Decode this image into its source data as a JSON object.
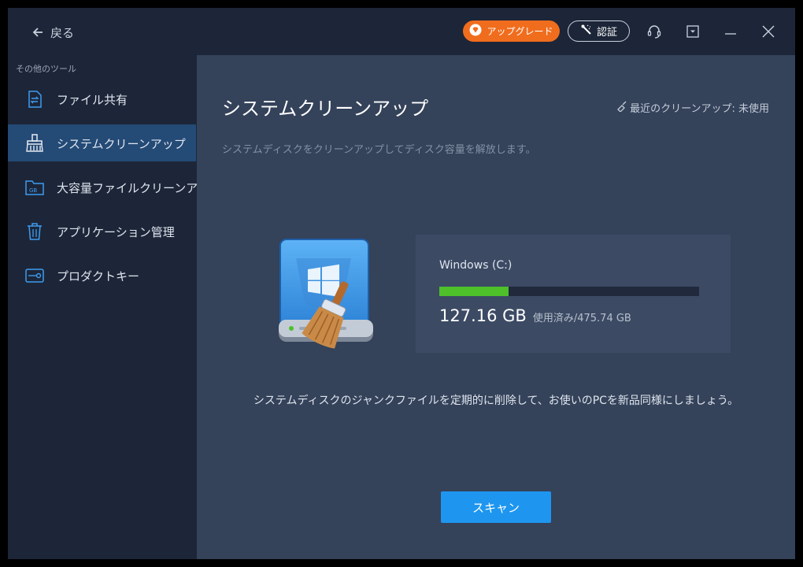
{
  "titlebar": {
    "back_label": "戻る",
    "upgrade_label": "アップグレード",
    "activate_label": "認証",
    "icons": [
      "support-icon",
      "menu-icon",
      "minimize-icon",
      "close-icon"
    ]
  },
  "sidebar": {
    "heading": "その他のツール",
    "items": [
      {
        "label": "ファイル共有",
        "icon": "file-share-icon"
      },
      {
        "label": "システムクリーンアップ",
        "icon": "broom-icon",
        "active": true
      },
      {
        "label": "大容量ファイルクリーンアップ",
        "icon": "gb-folder-icon"
      },
      {
        "label": "アプリケーション管理",
        "icon": "trash-icon"
      },
      {
        "label": "プロダクトキー",
        "icon": "key-icon"
      }
    ]
  },
  "main": {
    "title": "システムクリーンアップ",
    "last_cleanup": "最近のクリーンアップ: 未使用",
    "subtitle": "システムディスクをクリーンアップしてディスク容量を解放します。",
    "disk": {
      "name": "Windows (C:)",
      "used": "127.16 GB",
      "total_text": "使用済み/475.74 GB",
      "used_fraction": 0.267
    },
    "hint": "システムディスクのジャンクファイルを定期的に削除して、お使いのPCを新品同様にしましょう。",
    "scan_label": "スキャン"
  },
  "colors": {
    "accent": "#1e96f0",
    "upgrade": "#f06d1d",
    "usage_bar": "#4ec02a",
    "sidebar_active": "#244a76"
  }
}
